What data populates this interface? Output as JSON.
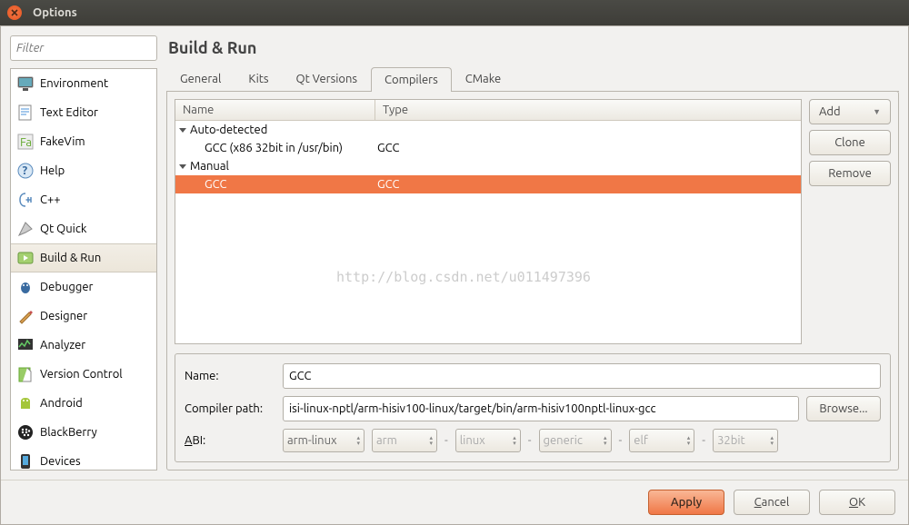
{
  "window": {
    "title": "Options"
  },
  "filter": {
    "placeholder": "Filter"
  },
  "categories": [
    {
      "id": "environment",
      "label": "Environment"
    },
    {
      "id": "text-editor",
      "label": "Text Editor"
    },
    {
      "id": "fakevim",
      "label": "FakeVim"
    },
    {
      "id": "help",
      "label": "Help"
    },
    {
      "id": "cpp",
      "label": "C++"
    },
    {
      "id": "qtquick",
      "label": "Qt Quick"
    },
    {
      "id": "build-run",
      "label": "Build & Run"
    },
    {
      "id": "debugger",
      "label": "Debugger"
    },
    {
      "id": "designer",
      "label": "Designer"
    },
    {
      "id": "analyzer",
      "label": "Analyzer"
    },
    {
      "id": "version-control",
      "label": "Version Control"
    },
    {
      "id": "android",
      "label": "Android"
    },
    {
      "id": "blackberry",
      "label": "BlackBerry"
    },
    {
      "id": "devices",
      "label": "Devices"
    }
  ],
  "page": {
    "title": "Build & Run"
  },
  "tabs": {
    "general": "General",
    "kits": "Kits",
    "qtversions": "Qt Versions",
    "compilers": "Compilers",
    "cmake": "CMake"
  },
  "tree": {
    "columns": {
      "name": "Name",
      "type": "Type"
    },
    "groups": {
      "auto": "Auto-detected",
      "manual": "Manual"
    },
    "items": {
      "auto0_name": "GCC (x86 32bit in /usr/bin)",
      "auto0_type": "GCC",
      "man0_name": "GCC",
      "man0_type": "GCC"
    }
  },
  "sidebtns": {
    "add": "Add",
    "clone": "Clone",
    "remove": "Remove"
  },
  "detail": {
    "name_label": "Name:",
    "name_value": "GCC",
    "path_label": "Compiler path:",
    "path_value": "isi-linux-nptl/arm-hisiv100-linux/target/bin/arm-hisiv100nptl-linux-gcc",
    "browse": "Browse...",
    "abi_label": "ABI:",
    "abi_main": "arm-linux",
    "abi_parts": [
      "arm",
      "linux",
      "generic",
      "elf",
      "32bit"
    ]
  },
  "footer": {
    "apply": "Apply",
    "cancel": "Cancel",
    "ok": "OK"
  },
  "watermark": "http://blog.csdn.net/u011497396"
}
